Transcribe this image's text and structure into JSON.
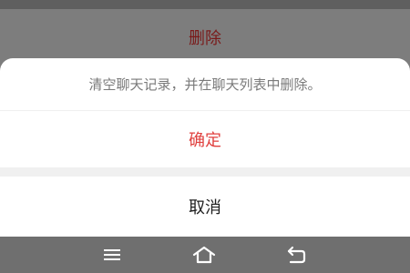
{
  "background": {
    "delete_label": "删除"
  },
  "action_sheet": {
    "message": "清空聊天记录，并在聊天列表中删除。",
    "confirm_label": "确定",
    "cancel_label": "取消"
  },
  "nav_bar": {
    "icons": [
      "menu-icon",
      "home-icon",
      "back-icon"
    ]
  },
  "colors": {
    "overlay": "#7d7d7d",
    "confirm": "#e0413f",
    "nav_bar": "#6f6f6f"
  }
}
